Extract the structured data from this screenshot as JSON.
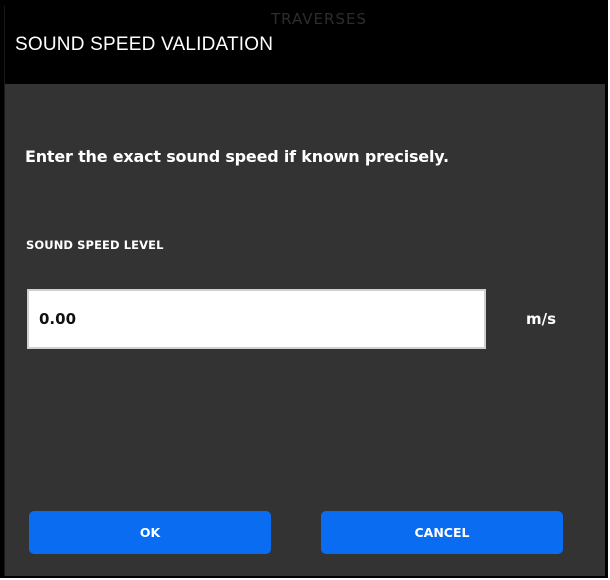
{
  "dialog": {
    "title": "SOUND SPEED VALIDATION",
    "background_text": "TRAVERSES",
    "instruction": "Enter the exact sound speed if known precisely.",
    "field": {
      "label": "SOUND SPEED LEVEL",
      "value": "0.00",
      "unit": "m/s"
    },
    "buttons": {
      "ok": "OK",
      "cancel": "CANCEL"
    }
  },
  "colors": {
    "accent": "#0a6cf0",
    "panel": "#333333",
    "titlebar": "#000000"
  }
}
